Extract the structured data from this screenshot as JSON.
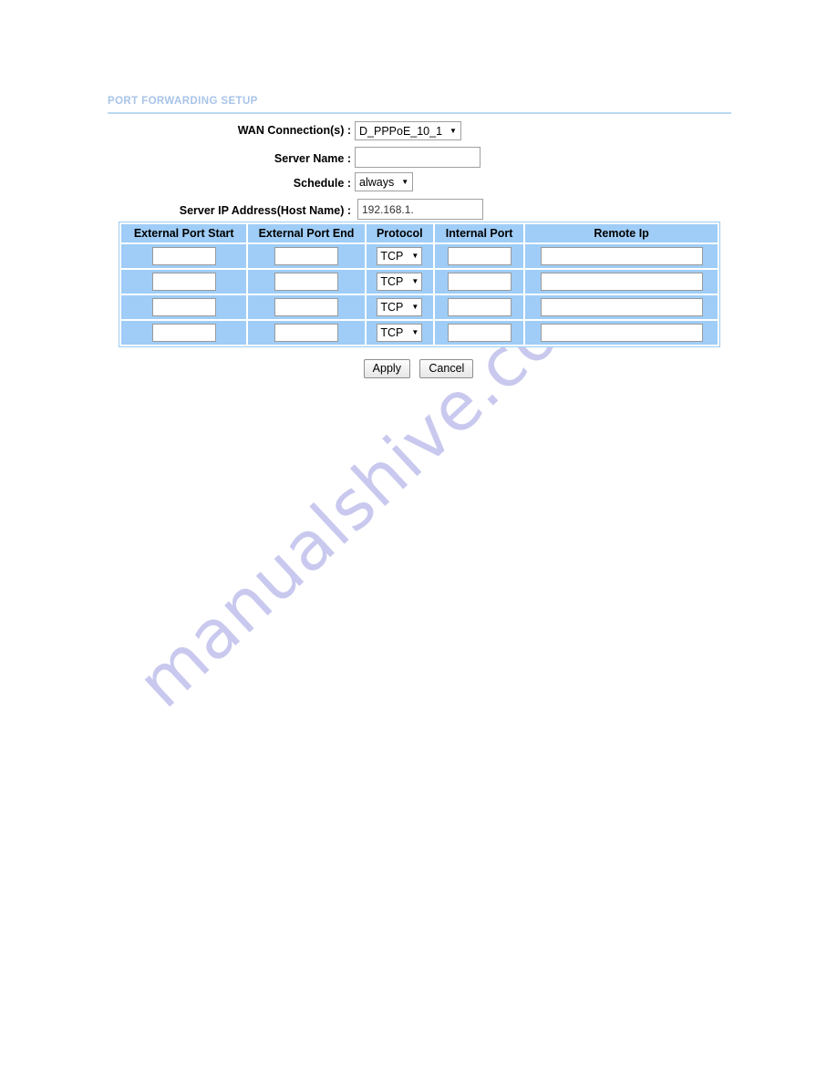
{
  "section": {
    "title": "PORT FORWARDING SETUP"
  },
  "form": {
    "wan_connection": {
      "label": "WAN Connection(s) :",
      "value": "D_PPPoE_10_1",
      "arrow": "▼"
    },
    "server_name": {
      "label": "Server Name :",
      "value": "",
      "placeholder": ""
    },
    "schedule": {
      "label": "Schedule :",
      "value": "always",
      "arrow": "▼"
    },
    "server_ip": {
      "label": "Server IP Address(Host Name) :",
      "value": "192.168.1.",
      "placeholder": ""
    }
  },
  "table": {
    "columns": [
      "External Port Start",
      "External Port End",
      "Protocol",
      "Internal Port",
      "Remote Ip"
    ],
    "rows": [
      {
        "external_port_start": "",
        "external_port_end": "",
        "protocol": "TCP",
        "internal_port": "",
        "remote_ip": ""
      },
      {
        "external_port_start": "",
        "external_port_end": "",
        "protocol": "TCP",
        "internal_port": "",
        "remote_ip": ""
      },
      {
        "external_port_start": "",
        "external_port_end": "",
        "protocol": "TCP",
        "internal_port": "",
        "remote_ip": ""
      },
      {
        "external_port_start": "",
        "external_port_end": "",
        "protocol": "TCP",
        "internal_port": "",
        "remote_ip": ""
      }
    ],
    "protocol_arrow": "▼"
  },
  "buttons": {
    "apply": "Apply",
    "cancel": "Cancel"
  },
  "watermark": {
    "text": "manualshive.com"
  },
  "colors": {
    "title_text": "#a9c4e8",
    "title_rule": "#bcd9ef",
    "table_cell_blue": "#9fcdf7",
    "table_border": "#9ccbf0",
    "watermark": "#c9c9ef",
    "input_border": "#9a9a9a",
    "text": "#000000"
  }
}
